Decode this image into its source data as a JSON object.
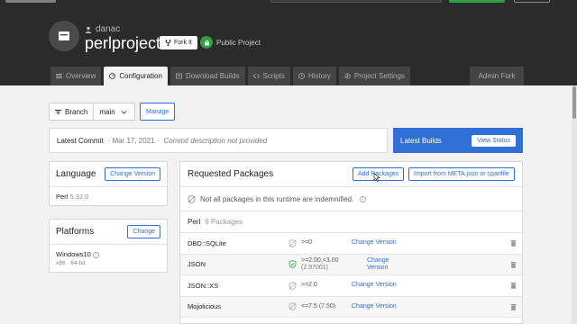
{
  "project": {
    "owner": "danac",
    "name": "perlproject",
    "fork_label": "Fork It",
    "visibility": "Public Project"
  },
  "tabs": [
    {
      "label": "Overview",
      "icon": "list-icon"
    },
    {
      "label": "Configuration",
      "icon": "gauge-icon"
    },
    {
      "label": "Download Builds",
      "icon": "download-icon"
    },
    {
      "label": "Scripts",
      "icon": "code-icon"
    },
    {
      "label": "History",
      "icon": "history-icon"
    },
    {
      "label": "Project Settings",
      "icon": "gear-icon"
    },
    {
      "label": "Admin Fork",
      "icon": ""
    }
  ],
  "active_tab": "Configuration",
  "branch": {
    "label": "Branch",
    "value": "main",
    "manage_label": "Manage"
  },
  "commit": {
    "label": "Latest Commit",
    "date": "· Mar 17, 2021 ·",
    "description": "Commit description not provided"
  },
  "builds": {
    "label": "Latest Builds",
    "view_status": "View Status"
  },
  "language": {
    "title": "Language",
    "change_label": "Change Version",
    "name": "Perl",
    "version": "5.32.0"
  },
  "platforms": {
    "title": "Platforms",
    "change_label": "Change",
    "name": "Windows10",
    "sub": "x86 · 64-bit"
  },
  "requested": {
    "title": "Requested Packages",
    "add_label": "Add Packages",
    "import_label": "Import from META.json or cpanfile",
    "indemnified_note": "Not all packages in this runtime are indemnified.",
    "group_name": "Perl",
    "group_count": "6 Packages",
    "packages": [
      {
        "name": "DBD::SQLite",
        "version": ">=0",
        "resolved": "",
        "change": "Change Version",
        "shield_color": "#aaaaaa"
      },
      {
        "name": "JSON",
        "version": ">=2.00,<3.00",
        "resolved": "(2.97001)",
        "change": "Change Version",
        "shield_color": "#2ea043"
      },
      {
        "name": "JSON::XS",
        "version": ">=2.0",
        "resolved": "",
        "change": "Change Version",
        "shield_color": "#aaaaaa"
      },
      {
        "name": "Mojolicious",
        "version": "<=7.5 (7.50)",
        "resolved": "",
        "change": "Change Version",
        "shield_color": "#aaaaaa"
      }
    ]
  },
  "colors": {
    "header_bg": "#2b2b2b",
    "accent": "#2f6fd6",
    "public_green": "#2ea043"
  }
}
